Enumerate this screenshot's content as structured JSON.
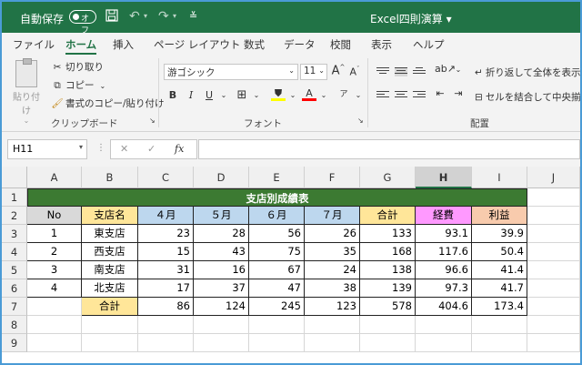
{
  "titlebar": {
    "autosave_label": "自動保存",
    "autosave_state": "オフ",
    "doc_title": "Excel四則演算 ▾"
  },
  "tabs": [
    "ファイル",
    "ホーム",
    "挿入",
    "ページ レイアウト",
    "数式",
    "データ",
    "校閲",
    "表示",
    "ヘルプ"
  ],
  "active_tab": "ホーム",
  "ribbon": {
    "clipboard": {
      "paste": "貼り付け",
      "cut": "切り取り",
      "copy": "コピー",
      "format_painter": "書式のコピー/貼り付け",
      "group": "クリップボード"
    },
    "font": {
      "name": "游ゴシック",
      "size": "11",
      "grow": "A",
      "shrink": "A",
      "bold": "B",
      "italic": "I",
      "underline": "U",
      "group": "フォント"
    },
    "alignment": {
      "wrap_text": "折り返して全体を表示す",
      "merge_center": "セルを結合して中央揃え",
      "group": "配置"
    }
  },
  "formula_bar": {
    "name_box": "H11",
    "formula": ""
  },
  "columns": [
    "A",
    "B",
    "C",
    "D",
    "E",
    "F",
    "G",
    "H",
    "I",
    "J"
  ],
  "selected_column": "H",
  "rows": [
    "1",
    "2",
    "3",
    "4",
    "5",
    "6",
    "7",
    "8",
    "9"
  ],
  "sheet": {
    "title": "支店別成績表",
    "headers": [
      "No",
      "支店名",
      "４月",
      "５月",
      "６月",
      "７月",
      "合計",
      "経費",
      "利益"
    ],
    "data": [
      [
        "1",
        "東支店",
        "23",
        "28",
        "56",
        "26",
        "133",
        "93.1",
        "39.9"
      ],
      [
        "2",
        "西支店",
        "15",
        "43",
        "75",
        "35",
        "168",
        "117.6",
        "50.4"
      ],
      [
        "3",
        "南支店",
        "31",
        "16",
        "67",
        "24",
        "138",
        "96.6",
        "41.4"
      ],
      [
        "4",
        "北支店",
        "17",
        "37",
        "47",
        "38",
        "139",
        "97.3",
        "41.7"
      ]
    ],
    "total": [
      "",
      "合計",
      "86",
      "124",
      "245",
      "123",
      "578",
      "404.6",
      "173.4"
    ]
  },
  "colors": {
    "accent": "#217346",
    "banner": "#3c7a32",
    "hdr_gray": "#d9d9d9",
    "hdr_yellow": "#ffe699",
    "hdr_blue": "#bdd7ee",
    "hdr_pink": "#ff99ff",
    "hdr_orange": "#f8cbad"
  }
}
